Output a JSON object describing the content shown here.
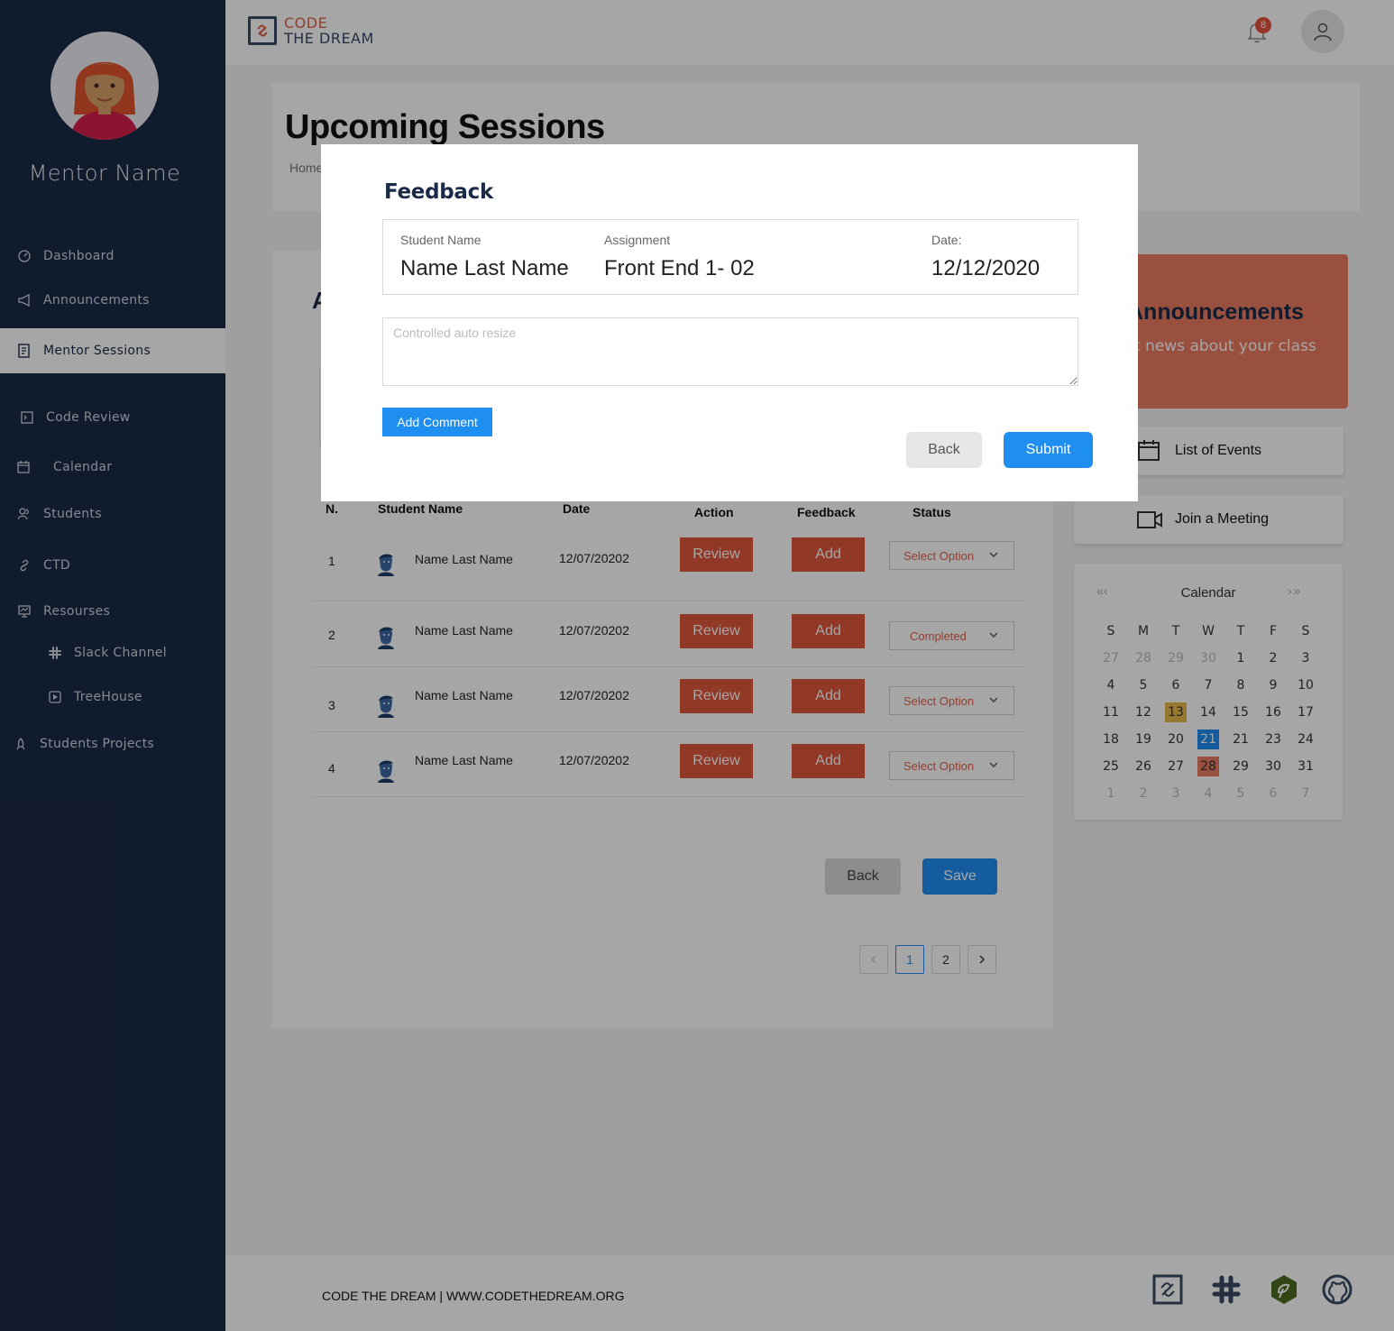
{
  "sidebar": {
    "mentor_name": "Mentor Name",
    "items": [
      {
        "label": "Dashboard",
        "icon": "dashboard-icon"
      },
      {
        "label": "Announcements",
        "icon": "megaphone-icon"
      },
      {
        "label": "Mentor Sessions",
        "icon": "document-icon"
      },
      {
        "label": "Code Review",
        "icon": "terminal-icon"
      },
      {
        "label": "Calendar",
        "icon": "calendar-icon"
      },
      {
        "label": "Students",
        "icon": "users-icon"
      },
      {
        "label": "CTD",
        "icon": "link-icon"
      },
      {
        "label": "Resourses",
        "icon": "presentation-icon"
      },
      {
        "label": "Slack Channel",
        "icon": "slack-icon"
      },
      {
        "label": "TreeHouse",
        "icon": "play-icon"
      },
      {
        "label": "Students Projects",
        "icon": "rocket-icon"
      }
    ],
    "active": "Mentor Sessions"
  },
  "header": {
    "logo_line1": "CODE",
    "logo_line2": "THE DREAM",
    "notification_count": "8"
  },
  "page": {
    "title": "Upcoming Sessions",
    "breadcrumb": "Home"
  },
  "table": {
    "card_title_initial": "A",
    "columns": [
      "N.",
      "Student Name",
      "Date",
      "Action",
      "Feedback",
      "Status"
    ],
    "rows": [
      {
        "n": "1",
        "name": "Name Last Name",
        "date": "12/07/20202",
        "action": "Review",
        "feedback": "Add",
        "status": "Select Option"
      },
      {
        "n": "2",
        "name": "Name Last Name",
        "date": "12/07/20202",
        "action": "Review",
        "feedback": "Add",
        "status": "Completed"
      },
      {
        "n": "3",
        "name": "Name Last Name",
        "date": "12/07/20202",
        "action": "Review",
        "feedback": "Add",
        "status": "Select Option"
      },
      {
        "n": "4",
        "name": "Name Last Name",
        "date": "12/07/20202",
        "action": "Review",
        "feedback": "Add",
        "status": "Select Option"
      }
    ],
    "back_label": "Back",
    "save_label": "Save",
    "pages": [
      "1",
      "2"
    ],
    "current_page": "1"
  },
  "announcements": {
    "title": "Announcements",
    "subtitle": "t news about your class"
  },
  "side_buttons": {
    "events": "List of Events",
    "meeting": "Join a Meeting"
  },
  "calendar": {
    "title": "Calendar",
    "weekdays": [
      "S",
      "M",
      "T",
      "W",
      "T",
      "F",
      "S"
    ],
    "weeks": [
      [
        "27",
        "28",
        "29",
        "30",
        "1",
        "2",
        "3"
      ],
      [
        "4",
        "5",
        "6",
        "7",
        "8",
        "9",
        "10"
      ],
      [
        "11",
        "12",
        "13",
        "14",
        "15",
        "16",
        "17"
      ],
      [
        "18",
        "19",
        "20",
        "21",
        "21",
        "23",
        "24"
      ],
      [
        "25",
        "26",
        "27",
        "28",
        "29",
        "30",
        "31"
      ],
      [
        "1",
        "2",
        "3",
        "4",
        "5",
        "6",
        "7"
      ]
    ],
    "highlights": {
      "13": "#e8b84a",
      "21": "#1f8ef1",
      "28": "#ec7c62"
    }
  },
  "footer": {
    "text": "CODE THE DREAM | WWW.CODETHEDREAM.ORG",
    "icons": [
      "ctd-logo-icon",
      "slack-icon",
      "treehouse-icon",
      "github-icon"
    ]
  },
  "modal": {
    "title": "Feedback",
    "student_label": "Student Name",
    "student_value": "Name Last Name",
    "assignment_label": "Assignment",
    "assignment_value": "Front End 1- 02",
    "date_label": "Date:",
    "date_value": "12/12/2020",
    "textarea_placeholder": "Controlled auto resize",
    "add_comment": "Add Comment",
    "back": "Back",
    "submit": "Submit"
  },
  "colors": {
    "sidebar_bg": "#1b2a47",
    "accent_red": "#e0563c",
    "accent_blue": "#1f8ef1",
    "announcement_bg": "#ec7c62"
  }
}
